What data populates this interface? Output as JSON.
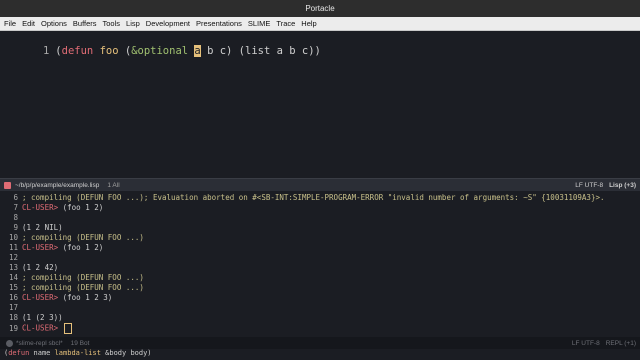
{
  "window": {
    "title": "Portacle"
  },
  "menu": [
    "File",
    "Edit",
    "Options",
    "Buffers",
    "Tools",
    "Lisp",
    "Development",
    "Presentations",
    "SLIME",
    "Trace",
    "Help"
  ],
  "editor": {
    "line_number": "1",
    "tokens": [
      "(",
      "defun",
      " ",
      "foo",
      " (",
      "&optional",
      " ",
      "a",
      " b c) (list a b c))"
    ]
  },
  "modeline_top": {
    "path": "~/b/p/p/example/example.lisp",
    "position": "1 All",
    "encoding": "LF UTF-8",
    "mode": "Lisp (+3)"
  },
  "repl_lines": [
    {
      "n": "6",
      "kind": "comment",
      "text": "; compiling (DEFUN FOO ...); Evaluation aborted on #<SB-INT:SIMPLE-PROGRAM-ERROR \"invalid number of arguments: ~S\" {10031109A3}>."
    },
    {
      "n": "7",
      "kind": "prompt",
      "prompt": "CL-USER> ",
      "text": "(foo 1 2)"
    },
    {
      "n": "8",
      "kind": "output",
      "text": ""
    },
    {
      "n": "9",
      "kind": "output",
      "text": "(1 2 NIL)"
    },
    {
      "n": "10",
      "kind": "comment",
      "text": "; compiling (DEFUN FOO ...)"
    },
    {
      "n": "11",
      "kind": "prompt",
      "prompt": "CL-USER> ",
      "text": "(foo 1 2)"
    },
    {
      "n": "12",
      "kind": "output",
      "text": ""
    },
    {
      "n": "13",
      "kind": "output",
      "text": "(1 2 42)"
    },
    {
      "n": "14",
      "kind": "comment",
      "text": "; compiling (DEFUN FOO ...)"
    },
    {
      "n": "15",
      "kind": "comment",
      "text": "; compiling (DEFUN FOO ...)"
    },
    {
      "n": "16",
      "kind": "prompt",
      "prompt": "CL-USER> ",
      "text": "(foo 1 2 3)"
    },
    {
      "n": "17",
      "kind": "output",
      "text": ""
    },
    {
      "n": "18",
      "kind": "output",
      "text": "(1 (2 3))"
    },
    {
      "n": "19",
      "kind": "prompt",
      "prompt": "CL-USER> ",
      "text": ""
    }
  ],
  "modeline_bottom": {
    "buffer": "*slime-repl sbcl*",
    "position": "19 Bot",
    "encoding": "LF UTF-8",
    "mode": "REPL (+1)"
  },
  "echo": {
    "open": "(",
    "kw": "defun",
    "rest1": " name ",
    "arg": "lambda-list",
    "rest2": " &body body)"
  },
  "colors": {
    "background": "#1b1d23",
    "keyword": "#e06c75",
    "function": "#e5c07b",
    "optional": "#a0c070",
    "comment": "#c8c08a"
  }
}
